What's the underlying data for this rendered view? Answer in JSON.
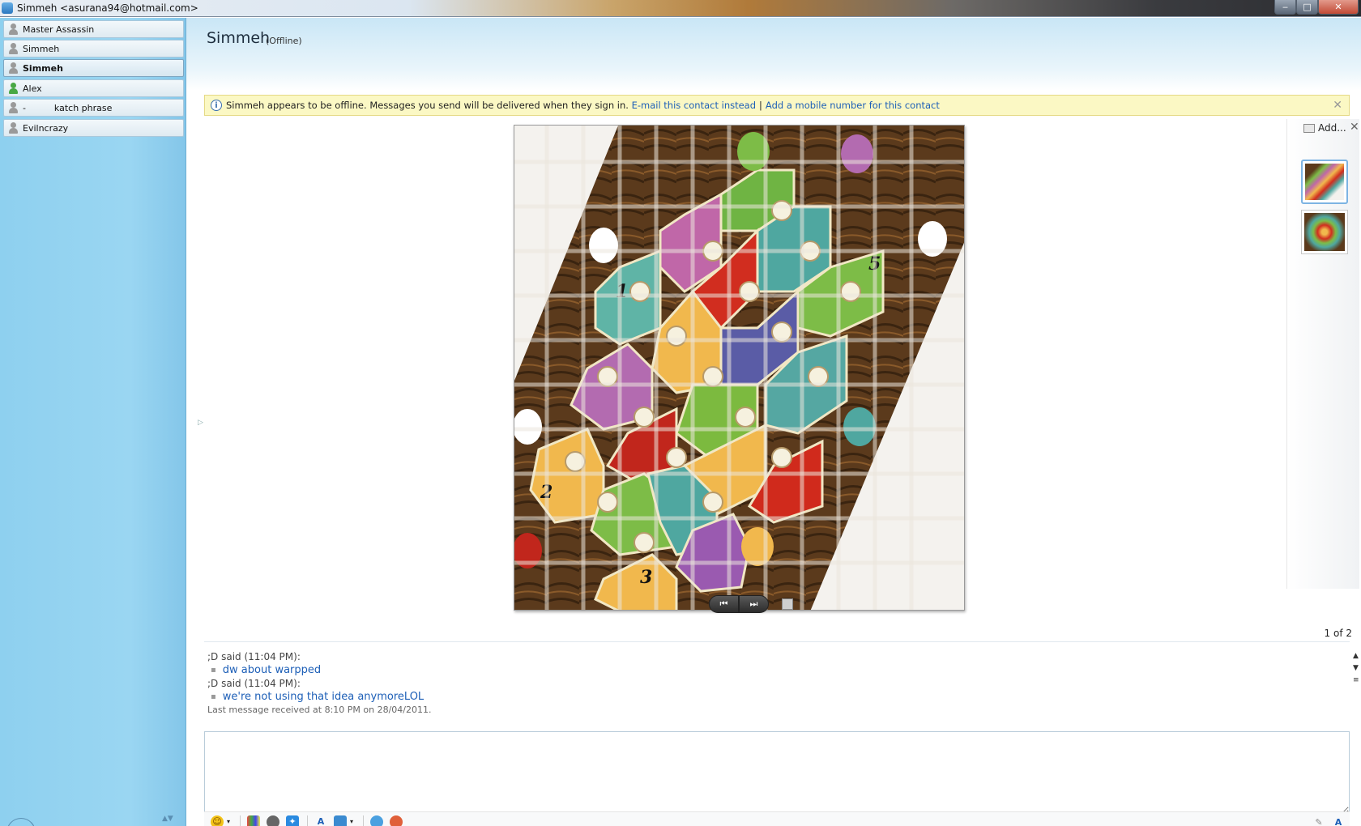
{
  "window": {
    "title": "Simmeh <asurana94@hotmail.com>",
    "minimize": "‒",
    "maximize": "□",
    "close": "✕"
  },
  "contacts": [
    {
      "name": "Master Assassin",
      "status": "offline"
    },
    {
      "name": "Simmeh",
      "status": "offline"
    },
    {
      "name": "Simmeh",
      "status": "offline",
      "active": true
    },
    {
      "name": "Alex",
      "status": "online"
    },
    {
      "name": "-          katch phrase",
      "status": "offline"
    },
    {
      "name": "Evilncrazy",
      "status": "offline"
    }
  ],
  "header": {
    "name": "Simmeh",
    "status": "(Offline)"
  },
  "infobar": {
    "icon": "info-icon",
    "message": "Simmeh appears to be offline. Messages you send will be delivered when they sign in.",
    "email_link": "E-mail this contact instead",
    "separator": "|",
    "mobile_link": "Add a mobile number for this contact",
    "close": "✕"
  },
  "photo_share": {
    "prev_icon": "⏮",
    "next_icon": "⏭",
    "add_label": "Add...",
    "close": "✕",
    "counter": "1 of 2",
    "board_numbers": [
      "1",
      "2",
      "3",
      "5"
    ]
  },
  "history": {
    "messages": [
      {
        "sender": ";D said (11:04 PM):",
        "text": "dw about warpped"
      },
      {
        "sender": ";D said (11:04 PM):",
        "text": "we're not using that idea anymoreLOL"
      }
    ],
    "last_received": "Last message received at 8:10 PM on 28/04/2011."
  },
  "compose": {
    "value": ""
  },
  "colors": {
    "link": "#1d5fb7",
    "sidebar": "#8ed0ef",
    "infobar_bg": "#fbf8c4"
  }
}
